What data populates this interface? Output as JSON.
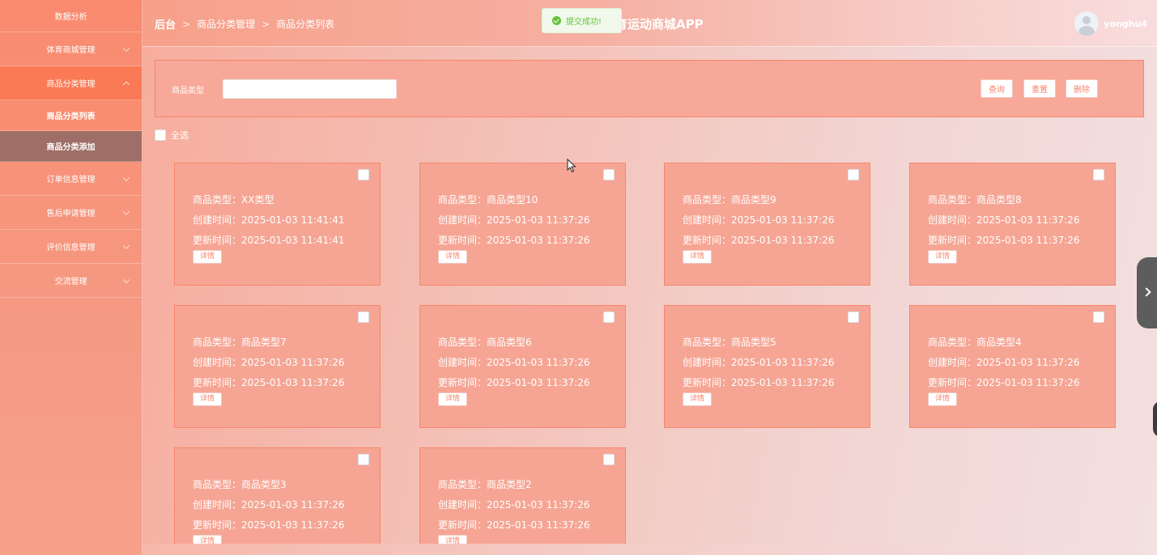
{
  "sidebar": {
    "items": [
      {
        "label": "数据分析"
      },
      {
        "label": "体育商城管理"
      },
      {
        "label": "商品分类管理"
      },
      {
        "label": "订单信息管理"
      },
      {
        "label": "售后申请管理"
      },
      {
        "label": "评价信息管理"
      },
      {
        "label": "交流管理"
      }
    ],
    "subitems": [
      {
        "label": "商品分类列表"
      },
      {
        "label": "商品分类添加"
      }
    ]
  },
  "header": {
    "breadcrumb": [
      "后台",
      "商品分类管理",
      "商品分类列表"
    ],
    "separator": ">",
    "app_title": "育运动商城APP",
    "toast": "提交成功!",
    "username": "yonghu4"
  },
  "search": {
    "label": "商品类型",
    "value": "",
    "query_label": "查询",
    "reset_label": "重置",
    "delete_label": "删除"
  },
  "select_all_label": "全选",
  "card_labels": {
    "type": "商品类型：",
    "created": "创建时间：",
    "updated": "更新时间：",
    "detail": "详情"
  },
  "cards": [
    {
      "type": "XX类型",
      "created": "2025-01-03 11:41:41",
      "updated": "2025-01-03 11:41:41"
    },
    {
      "type": "商品类型10",
      "created": "2025-01-03 11:37:26",
      "updated": "2025-01-03 11:37:26"
    },
    {
      "type": "商品类型9",
      "created": "2025-01-03 11:37:26",
      "updated": "2025-01-03 11:37:26"
    },
    {
      "type": "商品类型8",
      "created": "2025-01-03 11:37:26",
      "updated": "2025-01-03 11:37:26"
    },
    {
      "type": "商品类型7",
      "created": "2025-01-03 11:37:26",
      "updated": "2025-01-03 11:37:26"
    },
    {
      "type": "商品类型6",
      "created": "2025-01-03 11:37:26",
      "updated": "2025-01-03 11:37:26"
    },
    {
      "type": "商品类型5",
      "created": "2025-01-03 11:37:26",
      "updated": "2025-01-03 11:37:26"
    },
    {
      "type": "商品类型4",
      "created": "2025-01-03 11:37:26",
      "updated": "2025-01-03 11:37:26"
    },
    {
      "type": "商品类型3",
      "created": "2025-01-03 11:37:26",
      "updated": "2025-01-03 11:37:26"
    },
    {
      "type": "商品类型2",
      "created": "2025-01-03 11:37:26",
      "updated": "2025-01-03 11:37:26"
    }
  ],
  "colors": {
    "accent": "#f7866e",
    "active_sub": "#9e6f66",
    "toast_green": "#67c23a"
  }
}
